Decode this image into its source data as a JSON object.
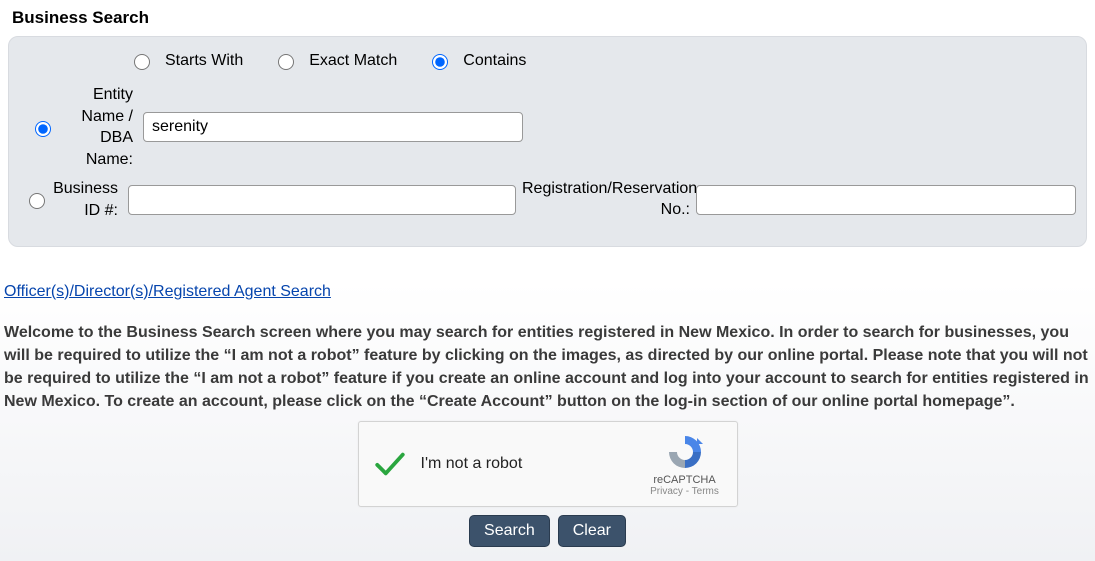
{
  "header": {
    "title": "Business Search"
  },
  "match_types": {
    "starts_with": "Starts With",
    "exact_match": "Exact Match",
    "contains": "Contains",
    "selected": "contains"
  },
  "search_by": {
    "selected": "entity",
    "entity_label": "Entity Name / DBA Name:",
    "entity_value": "serenity",
    "business_id_label": "Business ID #:",
    "business_id_value": "",
    "reg_no_label": "Registration/Reservation No.:",
    "reg_no_value": ""
  },
  "agent_link": "Officer(s)/Director(s)/Registered Agent Search",
  "welcome_text": "Welcome to the Business Search screen where you may search for entities registered in New Mexico. In order to search for businesses, you will be required to utilize the “I am not a robot” feature by clicking on the images, as directed by our online portal. Please note that you will not be required to utilize the “I am not a robot” feature if you create an online account and log into your account to search for entities registered in New Mexico. To create an account, please click on the “Create Account” button on the log-in section of our online portal homepage”.",
  "captcha": {
    "label": "I'm not a robot",
    "brand": "reCAPTCHA",
    "terms": "Privacy - Terms",
    "checked": true
  },
  "buttons": {
    "search": "Search",
    "clear": "Clear"
  }
}
